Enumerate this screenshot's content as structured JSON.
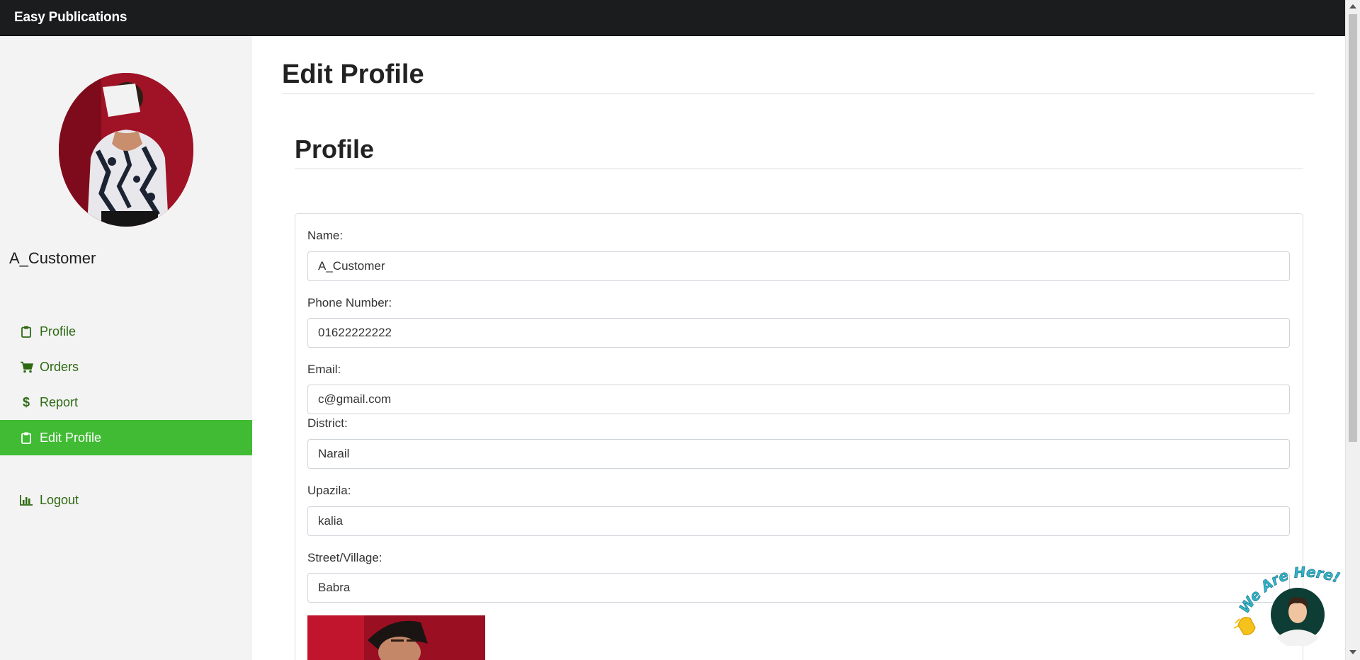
{
  "navbar": {
    "brand": "Easy Publications"
  },
  "sidebar": {
    "username": "A_Customer",
    "items": [
      {
        "label": "Profile",
        "icon": "clipboard-icon",
        "active": false
      },
      {
        "label": "Orders",
        "icon": "cart-icon",
        "active": false
      },
      {
        "label": "Report",
        "icon": "dollar-icon",
        "active": false
      },
      {
        "label": "Edit Profile",
        "icon": "clipboard-icon",
        "active": true
      },
      {
        "label": "Logout",
        "icon": "bar-chart-icon",
        "active": false
      }
    ]
  },
  "main": {
    "page_title": "Edit Profile",
    "section_title": "Profile",
    "fields": [
      {
        "label": "Name:",
        "value": "A_Customer"
      },
      {
        "label": "Phone Number:",
        "value": "01622222222"
      },
      {
        "label": "Email:",
        "value": "c@gmail.com"
      },
      {
        "label": "District:",
        "value": "Narail"
      },
      {
        "label": "Upazila:",
        "value": "kalia"
      },
      {
        "label": "Street/Village:",
        "value": "Babra"
      }
    ]
  },
  "widget": {
    "text": "We Are Here!"
  },
  "colors": {
    "accent": "#40bb33",
    "link": "#2d6a12",
    "navbar": "#1b1c1e",
    "sidebar": "#f3f3f3"
  }
}
